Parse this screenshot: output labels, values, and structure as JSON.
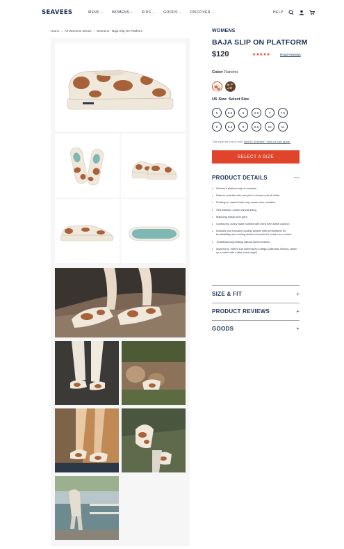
{
  "header": {
    "logo": "SEAVEES",
    "nav": [
      {
        "label": "MENS",
        "chevron": "⌄"
      },
      {
        "label": "WOMENS",
        "chevron": "⌄"
      },
      {
        "label": "KIDS",
        "chevron": "⌄"
      },
      {
        "label": "GOODS",
        "chevron": "⌄"
      },
      {
        "label": "DISCOVER",
        "chevron": "⌄"
      }
    ],
    "help_label": "HELP",
    "icons": [
      "search-icon",
      "account-icon",
      "cart-icon"
    ]
  },
  "breadcrumb": {
    "items": [
      "Home",
      "All Womens Shoes",
      "Womens - Baja Slip On Platform"
    ],
    "separator": "›"
  },
  "product": {
    "eyebrow": "WOMENS",
    "title": "BAJA SLIP ON PLATFORM",
    "price": "$120",
    "rating_stars": "★★★★★",
    "rating": 5,
    "reviews_link": "Read Reviews",
    "color_label": "Color:",
    "color_value": "Rancho",
    "swatches": [
      {
        "name": "rancho",
        "color": "#b8764e",
        "selected": true
      },
      {
        "name": "leopard",
        "color": "#5a4030",
        "selected": false
      }
    ],
    "size_label": "US Size: Select Size",
    "sizes": [
      "5",
      "5.5",
      "6",
      "6.5",
      "7",
      "7.5",
      "8",
      "8.5",
      "9",
      "9.5",
      "10",
      "11"
    ],
    "fit_note": "This style fits true to size.",
    "fit_link": "New to Seavees? Visit our size guide.",
    "cta": "SELECT A SIZE",
    "accordions": [
      {
        "title": "PRODUCT DETAILS",
        "sign": "—",
        "open": true
      },
      {
        "title": "SIZE & FIT",
        "sign": "+",
        "open": false
      },
      {
        "title": "PRODUCT REVIEWS",
        "sign": "+",
        "open": false
      },
      {
        "title": "GOODS",
        "sign": "+",
        "open": false
      }
    ],
    "details": [
      "Women's platform slip on sneaker",
      "Natural cowhide with cow print in brown and off white",
      "Printing on natural hide may cause color variation",
      "Soft washed, cotton canvas lining",
      "Matching elastic twin gore",
      "Contoured, cushy foam footbed with extra heel-strike cushion",
      "Includes our exclusive cooling system with perforations for breathability and cooling airflow channels for extra cool comfort",
      "Traditional long lasting natural rubber bottom",
      "Inspired by 1960's surf adventures to Baja California, Mexico, taken up a notch with a little extra height"
    ]
  },
  "colors": {
    "brand_navy": "#1c2f57",
    "accent_red": "#e0452b",
    "cow_brown": "#a8623a",
    "cream": "#f1e8dc",
    "sole_blue": "#7fb7b4"
  }
}
